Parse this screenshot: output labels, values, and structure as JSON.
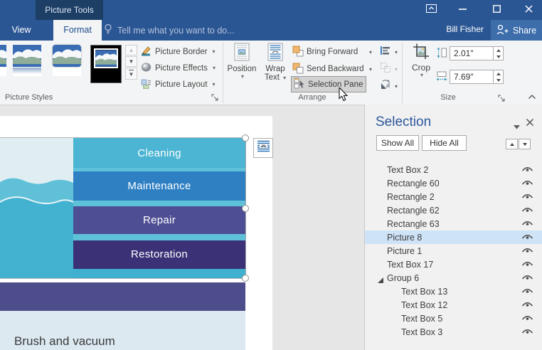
{
  "titlebar": {
    "context_tab_header": "Picture Tools"
  },
  "tabs": {
    "view": "View",
    "format": "Format"
  },
  "tellme": {
    "placeholder": "Tell me what you want to do..."
  },
  "account": {
    "user_name": "Bill Fisher",
    "share_label": "Share"
  },
  "ribbon": {
    "groups": {
      "picture_styles_label": "Picture Styles",
      "arrange_label": "Arrange",
      "size_label": "Size"
    },
    "picture_styles": {
      "picture_border": "Picture Border",
      "picture_effects": "Picture Effects",
      "picture_layout": "Picture Layout"
    },
    "arrange": {
      "position": "Position",
      "wrap_line1": "Wrap",
      "wrap_line2": "Text",
      "bring_forward": "Bring Forward",
      "send_backward": "Send Backward",
      "selection_pane": "Selection Pane"
    },
    "size": {
      "crop": "Crop",
      "height_value": "2.01\"",
      "width_value": "7.69\""
    }
  },
  "document": {
    "bars": [
      "Cleaning",
      "Maintenance",
      "Repair",
      "Restoration"
    ],
    "caption": "Brush and vacuum"
  },
  "selection_pane": {
    "title": "Selection",
    "show_all": "Show All",
    "hide_all": "Hide All",
    "items": [
      {
        "label": "Text Box 2"
      },
      {
        "label": "Rectangle 60"
      },
      {
        "label": "Rectangle 2"
      },
      {
        "label": "Rectangle 62"
      },
      {
        "label": "Rectangle 63"
      },
      {
        "label": "Picture 8",
        "selected": true
      },
      {
        "label": "Picture 1"
      },
      {
        "label": "Text Box 17"
      },
      {
        "label": "Group 6",
        "group": true,
        "expanded": true
      },
      {
        "label": "Text Box 13",
        "child": true
      },
      {
        "label": "Text Box 12",
        "child": true
      },
      {
        "label": "Text Box 5",
        "child": true
      },
      {
        "label": "Text Box 3",
        "child": true
      }
    ]
  },
  "colors": {
    "titlebar_blue": "#2b5694",
    "context_header_blue": "#1d3f66",
    "share_blue": "#3d6dab",
    "accent_blue": "#2b579a",
    "image_teal_bg": "#3fb0cf",
    "bar_cleaning": "#4bb5d3",
    "bar_maintenance": "#2e80c3",
    "bar_repair": "#4e4e94",
    "bar_restoration": "#3a3177",
    "band_purple": "#4e4d8c",
    "caption_bg": "#dce9f1",
    "selection_highlight": "#cfe3f7"
  }
}
